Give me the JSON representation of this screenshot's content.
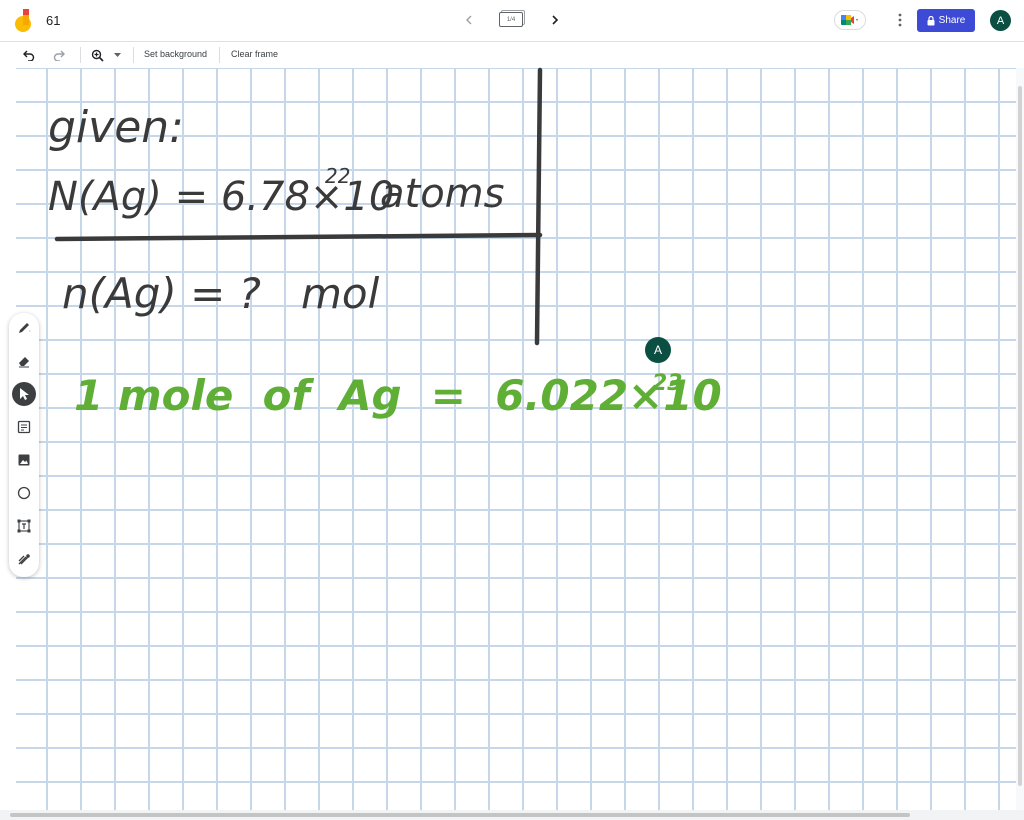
{
  "app": {
    "title": "61",
    "frame_indicator": "1/4",
    "share_label": "Share",
    "avatar_initial": "A",
    "accent_color": "#3c4ad6"
  },
  "toolbar": {
    "set_background": "Set background",
    "clear_frame": "Clear frame"
  },
  "tools": [
    "pen-icon",
    "eraser-icon",
    "select-icon",
    "sticky-note-icon",
    "image-icon",
    "shape-icon",
    "text-box-icon",
    "laser-icon"
  ],
  "board": {
    "line1": "given:",
    "line2_lhs": "N(Ag) = 6.78×10",
    "line2_exp": "22",
    "line2_unit": "atoms",
    "line3": "n(Ag) = ?   mol",
    "green_line": "1 mole  of  Ag  =  6.022×10",
    "green_exp": "23",
    "ink_dark": "#3a3a3a",
    "ink_green": "#5fae35"
  },
  "collaborator": {
    "initial": "A",
    "color": "#0b4f43"
  }
}
